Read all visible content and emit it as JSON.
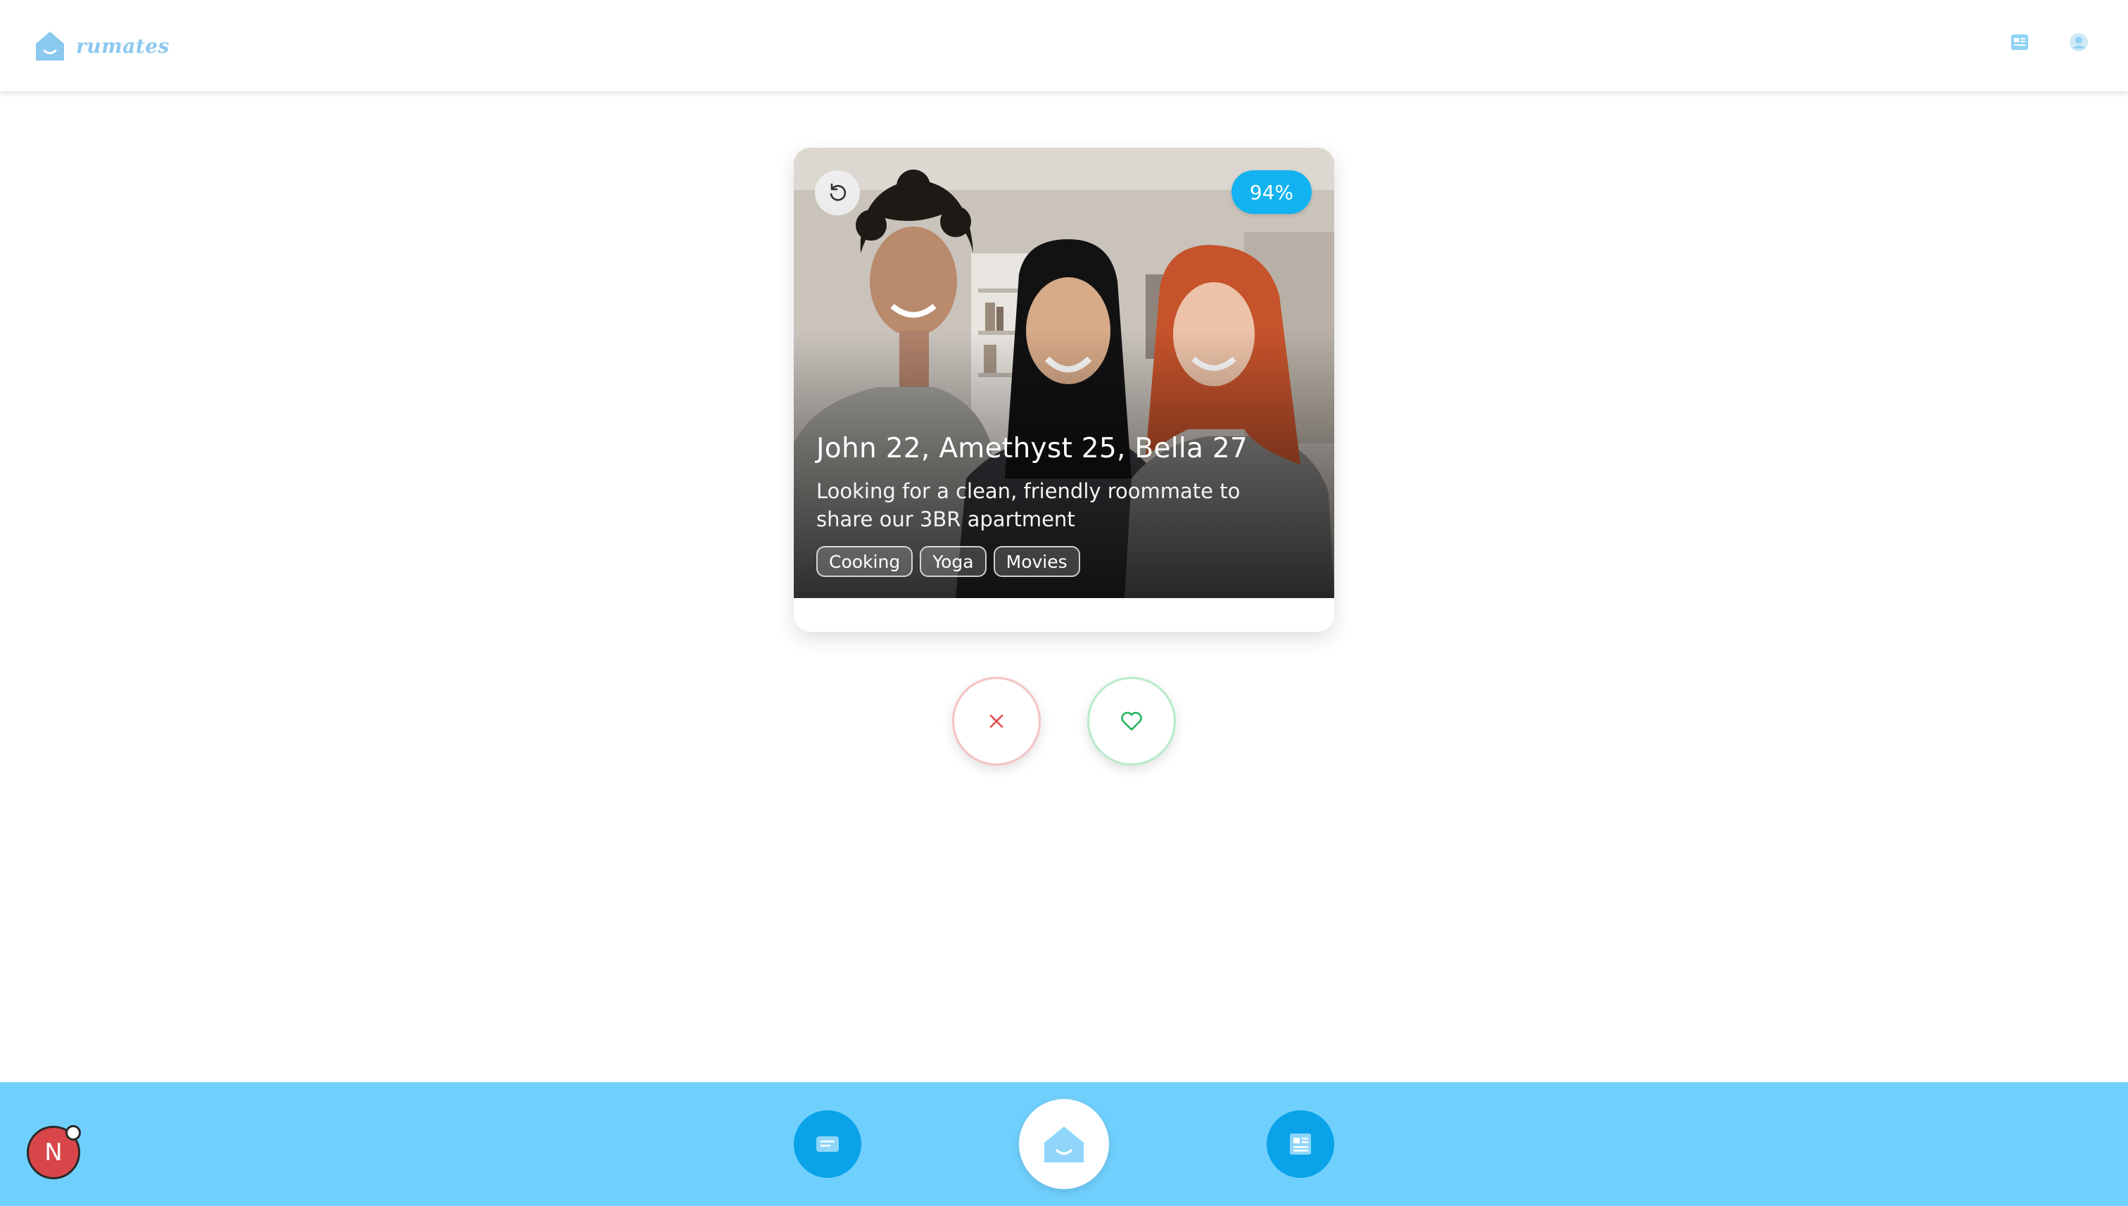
{
  "brand": {
    "name": "rumates",
    "icon": "house-smile-icon",
    "color": "#8cc9ef"
  },
  "header": {
    "news_icon": "newspaper-icon",
    "profile_icon": "user-circle-icon"
  },
  "card": {
    "match_percent": "94%",
    "names": "John 22, Amethyst 25, Bella 27",
    "description": "Looking for a clean, friendly roommate to share our 3BR apartment",
    "tags": [
      "Cooking",
      "Yoga",
      "Movies"
    ],
    "undo_icon": "undo-icon",
    "photo": "three-roommates-photo"
  },
  "actions": {
    "reject_icon": "close-icon",
    "like_icon": "heart-icon",
    "reject_color": "#e5484d",
    "like_color": "#22b35e"
  },
  "bottom_nav": {
    "items": [
      {
        "name": "messages",
        "icon": "message-icon"
      },
      {
        "name": "home",
        "icon": "house-smile-icon"
      },
      {
        "name": "listings",
        "icon": "newspaper-icon"
      }
    ],
    "background": "#70d0fd",
    "accent": "#0aa3ea"
  },
  "user_avatar": {
    "initial": "N",
    "color": "#d94649"
  }
}
